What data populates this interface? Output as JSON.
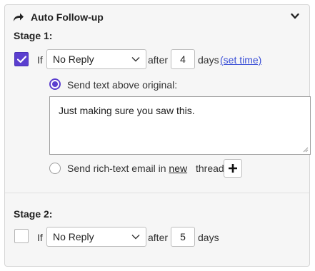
{
  "header": {
    "title": "Auto Follow-up",
    "share_icon": "share-forward-icon",
    "collapse_icon": "chevron-down-icon"
  },
  "stage1": {
    "label": "Stage 1:",
    "enabled": true,
    "if_label": "If",
    "condition": "No Reply",
    "after_label": "after",
    "days_value": "4",
    "days_label": "days",
    "set_time_link": "(set time)",
    "option_text": {
      "label": "Send text above original:",
      "selected": true,
      "message": "Just making sure you saw this."
    },
    "option_email": {
      "label_prefix": "Send rich-text email in",
      "label_link": "new",
      "label_suffix": "thread",
      "selected": false
    }
  },
  "stage2": {
    "label": "Stage 2:",
    "enabled": false,
    "if_label": "If",
    "condition": "No Reply",
    "after_label": "after",
    "days_value": "5",
    "days_label": "days"
  },
  "colors": {
    "accent": "#5b3fcf",
    "link": "#3a4fd6",
    "panel_bg": "#f6f6f6"
  }
}
